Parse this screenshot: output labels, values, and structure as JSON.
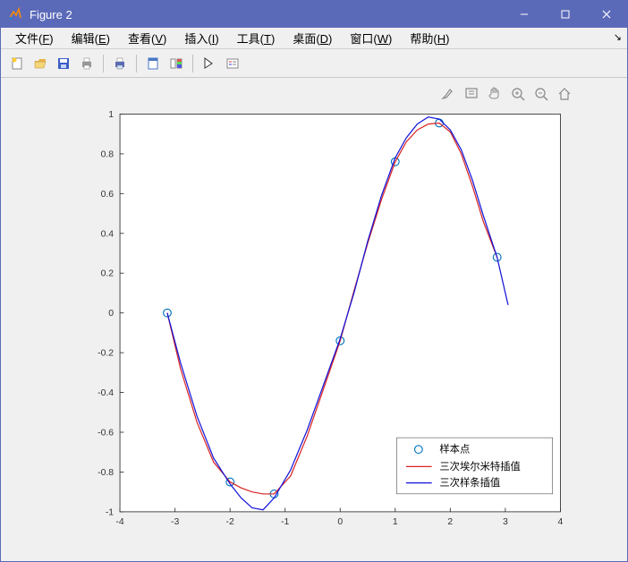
{
  "window": {
    "title": "Figure 2"
  },
  "menu": {
    "file": "文件(F)",
    "edit": "编辑(E)",
    "view": "查看(V)",
    "insert": "插入(I)",
    "tools": "工具(T)",
    "desktop": "桌面(D)",
    "window": "窗口(W)",
    "help": "帮助(H)"
  },
  "toolbar_icons": {
    "new": "new-figure",
    "open": "open",
    "save": "save",
    "print": "print",
    "printpreview": "print-preview",
    "link": "link-data",
    "colorbar": "colorbar",
    "cursor": "edit-cursor",
    "datacursor": "insert-legend"
  },
  "figtools": {
    "brush": "brush-icon",
    "datatip_box": "data-tip-icon",
    "pan": "pan-hand-icon",
    "zoomin": "zoom-in-icon",
    "zoomout": "zoom-out-icon",
    "home": "home-icon"
  },
  "legend": {
    "samples": "样本点",
    "hermite": "三次埃尔米特插值",
    "spline": "三次样条插值"
  },
  "chart_data": {
    "type": "line",
    "xlabel": "",
    "ylabel": "",
    "xlim": [
      -4,
      4
    ],
    "ylim": [
      -1,
      1
    ],
    "xticks": [
      -4,
      -3,
      -2,
      -1,
      0,
      1,
      2,
      3,
      4
    ],
    "yticks": [
      -1,
      -0.8,
      -0.6,
      -0.4,
      -0.2,
      0,
      0.2,
      0.4,
      0.6,
      0.8,
      1
    ],
    "series": [
      {
        "name": "样本点",
        "type": "scatter",
        "color": "#0072BD",
        "x": [
          -3.14,
          -2.0,
          -1.2,
          0.0,
          1.0,
          1.8,
          2.85
        ],
        "y": [
          0.0,
          -0.85,
          -0.91,
          -0.14,
          0.76,
          0.955,
          0.28
        ]
      },
      {
        "name": "三次埃尔米特插值",
        "type": "line",
        "color": "#D92323",
        "x": [
          -3.14,
          -2.9,
          -2.6,
          -2.3,
          -2.0,
          -1.8,
          -1.6,
          -1.4,
          -1.2,
          -0.9,
          -0.6,
          -0.3,
          0.0,
          0.25,
          0.5,
          0.75,
          1.0,
          1.2,
          1.4,
          1.6,
          1.8,
          2.0,
          2.2,
          2.4,
          2.6,
          2.85
        ],
        "y": [
          0.0,
          -0.28,
          -0.55,
          -0.75,
          -0.85,
          -0.88,
          -0.9,
          -0.91,
          -0.91,
          -0.82,
          -0.62,
          -0.38,
          -0.14,
          0.11,
          0.35,
          0.57,
          0.76,
          0.86,
          0.92,
          0.95,
          0.955,
          0.91,
          0.8,
          0.64,
          0.46,
          0.28
        ]
      },
      {
        "name": "三次样条插值",
        "type": "line",
        "color": "#1212D9",
        "x": [
          -3.14,
          -2.9,
          -2.6,
          -2.3,
          -2.0,
          -1.8,
          -1.6,
          -1.4,
          -1.2,
          -0.9,
          -0.6,
          -0.3,
          0.0,
          0.25,
          0.5,
          0.75,
          1.0,
          1.2,
          1.4,
          1.6,
          1.8,
          2.0,
          2.2,
          2.4,
          2.6,
          2.85,
          3.05
        ],
        "y": [
          0.0,
          -0.25,
          -0.52,
          -0.73,
          -0.86,
          -0.93,
          -0.98,
          -0.99,
          -0.93,
          -0.79,
          -0.59,
          -0.36,
          -0.13,
          0.1,
          0.36,
          0.59,
          0.78,
          0.88,
          0.95,
          0.985,
          0.975,
          0.92,
          0.82,
          0.67,
          0.49,
          0.28,
          0.04
        ]
      }
    ]
  }
}
